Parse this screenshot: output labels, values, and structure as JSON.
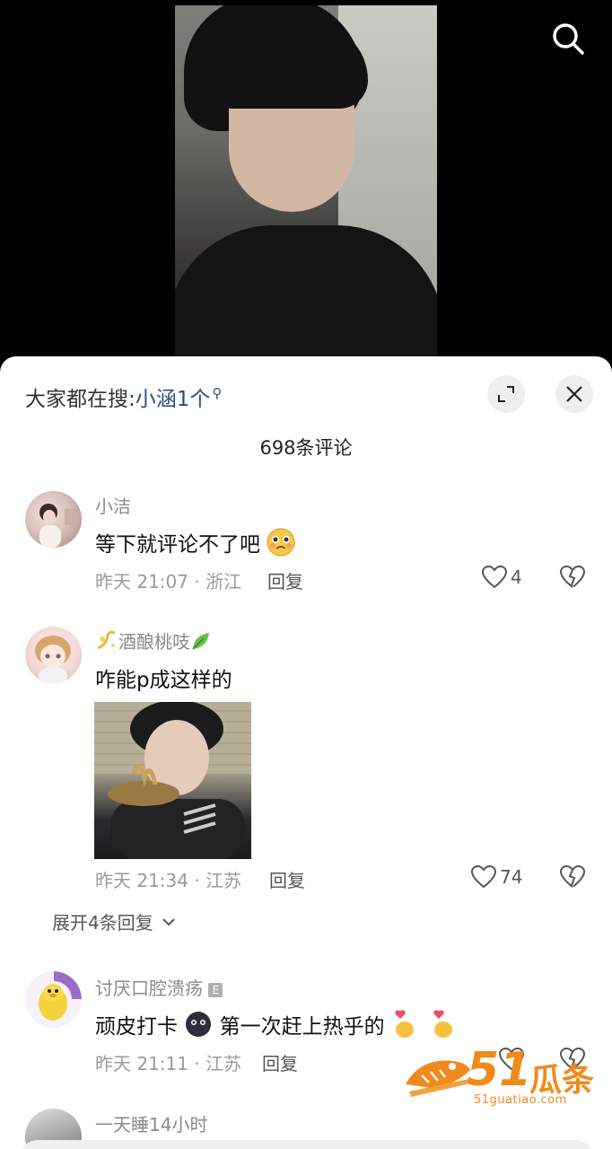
{
  "header": {
    "search_icon": "search-icon"
  },
  "sheet": {
    "hot_search_label": "大家都在搜:",
    "hot_search_keyword": "小涵1个",
    "hot_search_icon": "magnifier-small-icon",
    "expand_icon": "expand-icon",
    "close_icon": "close-icon",
    "comment_count": "698条评论"
  },
  "comments": [
    {
      "username": "小洁",
      "text": "等下就评论不了吧",
      "emoji": "pleading-face-emoji",
      "meta": "昨天 21:07 · 浙江",
      "reply": "回复",
      "likes": "4"
    },
    {
      "username": "酒酿桃吱",
      "username_prefix_icon": "dizzy-emoji",
      "username_suffix_icon": "leaf-emoji",
      "text": "咋能p成这样的",
      "meta": "昨天 21:34 · 江苏",
      "reply": "回复",
      "likes": "74",
      "expand_replies": "展开4条回复"
    },
    {
      "username": "讨厌口腔溃疡",
      "username_badge": "E",
      "text_before": "顽皮打卡",
      "text_after": "第一次赶上热乎的",
      "meta": "昨天 21:11 · 江苏",
      "reply": "回复"
    },
    {
      "username": "一天睡14小时"
    }
  ],
  "watermark": {
    "number": "51",
    "brand": "瓜条",
    "url": "51guatiao.com"
  },
  "colors": {
    "keyword": "#2c4f7a",
    "watermark": "#f08a1c"
  }
}
